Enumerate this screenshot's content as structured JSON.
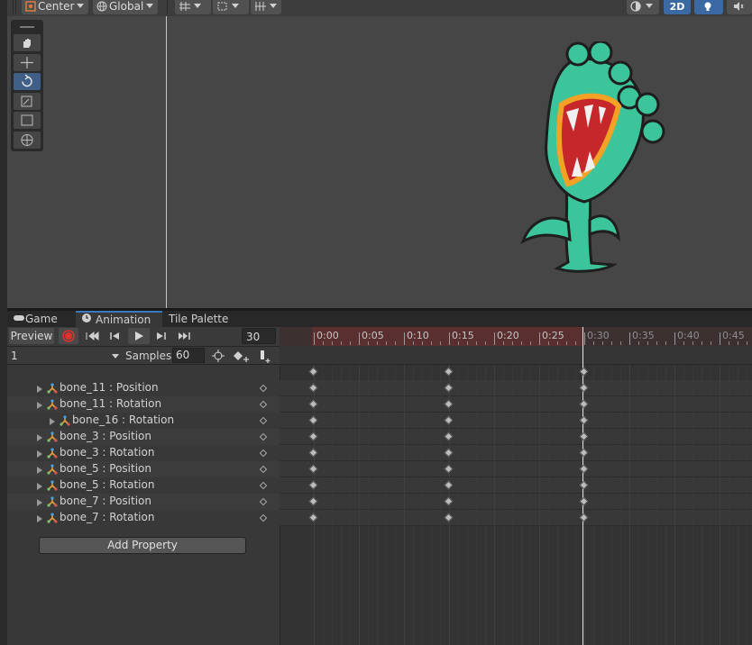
{
  "toolbar": {
    "pivot_mode": "Center",
    "pivot_rotation": "Global",
    "mode_2d": "2D"
  },
  "tabs": [
    {
      "label": "Game"
    },
    {
      "label": "Animation"
    },
    {
      "label": "Tile Palette"
    }
  ],
  "animation": {
    "preview_label": "Preview",
    "current_frame": "30",
    "clip_name": "1",
    "samples_label": "Samples",
    "samples_value": "60",
    "add_property_label": "Add Property",
    "time_ticks": [
      "0:00",
      "0:05",
      "0:10",
      "0:15",
      "0:20",
      "0:25",
      "0:30",
      "0:35",
      "0:40",
      "0:45"
    ],
    "properties": [
      {
        "label": "bone_11 : Position"
      },
      {
        "label": "bone_11 : Rotation"
      },
      {
        "label": "bone_16 : Rotation"
      },
      {
        "label": "bone_3 : Position"
      },
      {
        "label": "bone_3 : Rotation"
      },
      {
        "label": "bone_5 : Position"
      },
      {
        "label": "bone_5 : Rotation"
      },
      {
        "label": "bone_7 : Position"
      },
      {
        "label": "bone_7 : Rotation"
      }
    ],
    "keyframe_times": [
      "0:00",
      "0:15",
      "0:30"
    ]
  },
  "colors": {
    "record_red": "#e0302b",
    "selection_blue": "#3a79bb",
    "active_range": "#5a2f30",
    "character_green": "#3cc49a"
  }
}
